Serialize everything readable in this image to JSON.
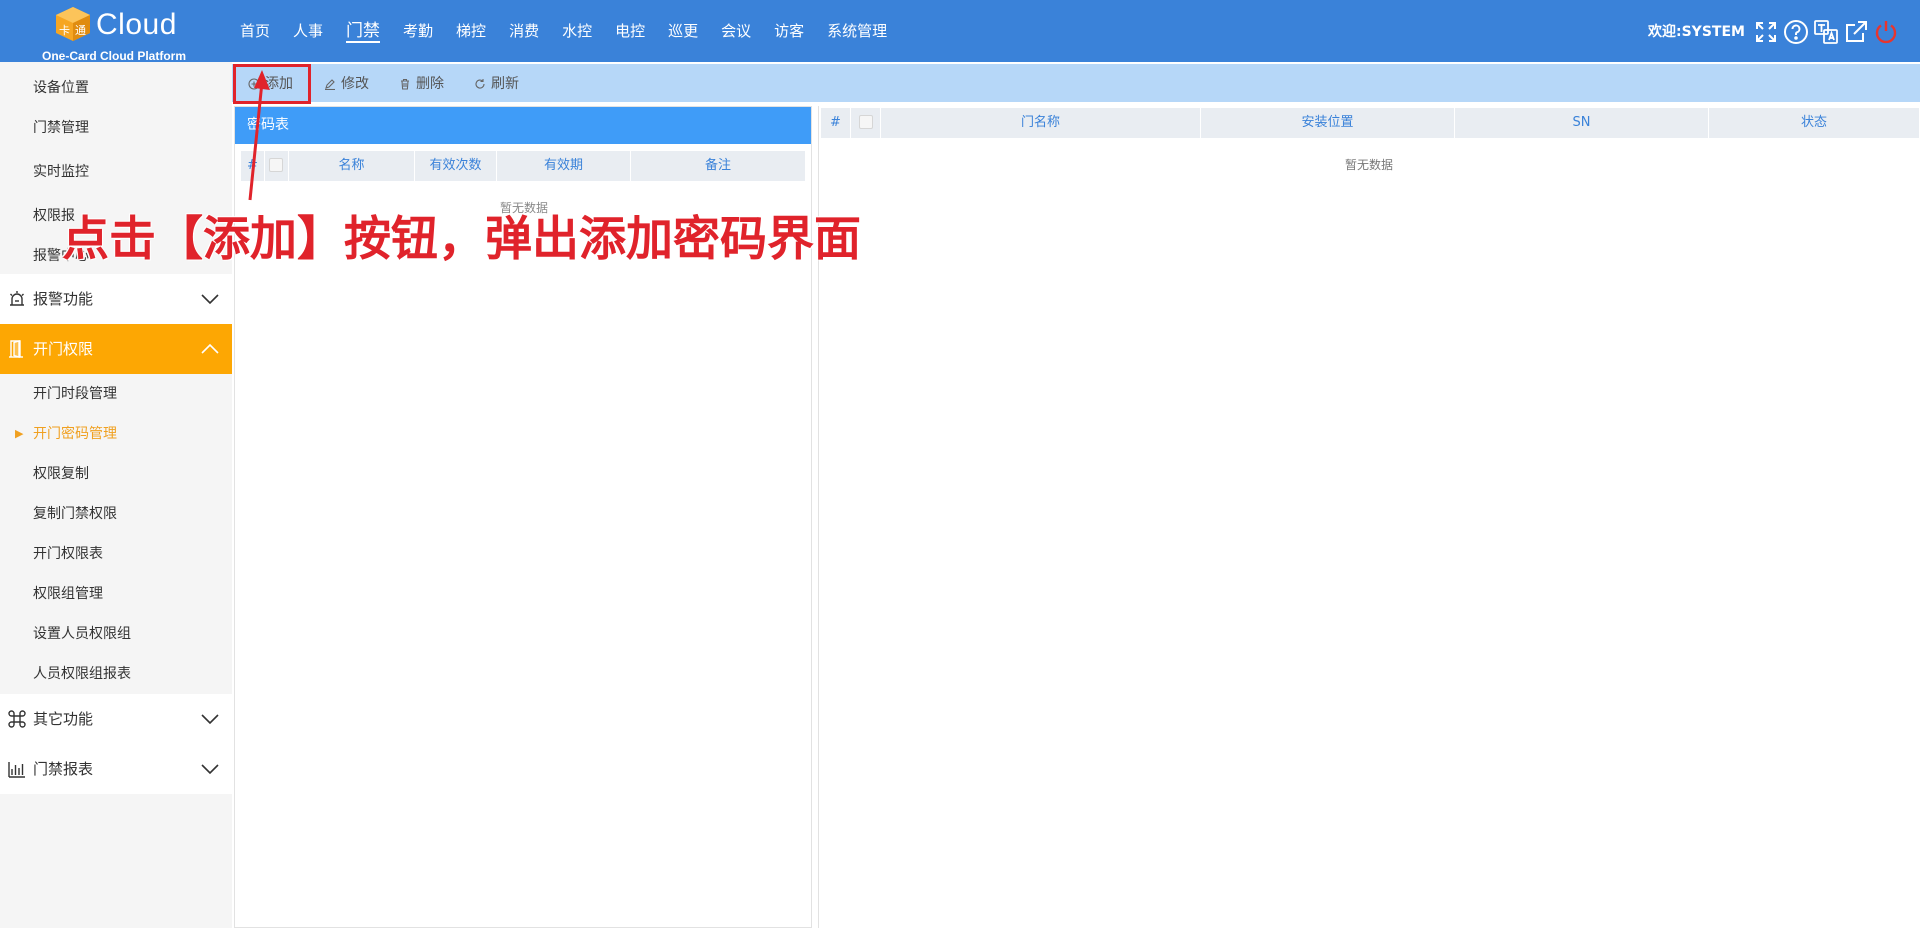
{
  "brand": {
    "word": "Cloud",
    "subtitle": "One-Card Cloud Platform",
    "accent": "#3a82d9"
  },
  "nav": [
    {
      "label": "首页"
    },
    {
      "label": "人事"
    },
    {
      "label": "门禁"
    },
    {
      "label": "考勤"
    },
    {
      "label": "梯控"
    },
    {
      "label": "消费"
    },
    {
      "label": "水控"
    },
    {
      "label": "电控"
    },
    {
      "label": "巡更"
    },
    {
      "label": "会议"
    },
    {
      "label": "访客"
    },
    {
      "label": "系统管理"
    }
  ],
  "nav_active": "门禁",
  "header": {
    "welcome": "欢迎:SYSTEM",
    "icons": [
      "fullscreen-icon",
      "help-icon",
      "translate-icon",
      "external-link-icon",
      "power-icon"
    ]
  },
  "sidebar": {
    "top_items": [
      {
        "label": "设备位置"
      },
      {
        "label": "门禁管理"
      },
      {
        "label": "实时监控"
      },
      {
        "label": "权限报"
      },
      {
        "label": "报警中心"
      }
    ],
    "group_alarm": {
      "label": "报警功能",
      "icon": "alarm-icon"
    },
    "group_door": {
      "label": "开门权限",
      "icon": "door-icon",
      "highlight": "#fda703"
    },
    "door_items": [
      {
        "label": "开门时段管理"
      },
      {
        "label": "开门密码管理"
      },
      {
        "label": "权限复制"
      },
      {
        "label": "复制门禁权限"
      },
      {
        "label": "开门权限表"
      },
      {
        "label": "权限组管理"
      },
      {
        "label": "设置人员权限组"
      },
      {
        "label": "人员权限组报表"
      }
    ],
    "door_active": "开门密码管理",
    "group_other": {
      "label": "其它功能",
      "icon": "command-icon"
    },
    "group_report": {
      "label": "门禁报表",
      "icon": "report-chart-icon"
    }
  },
  "toolbar": {
    "add": "添加",
    "edit": "修改",
    "delete": "删除",
    "refresh": "刷新"
  },
  "left_panel": {
    "title": "密码表",
    "columns": [
      "#",
      "名称",
      "有效次数",
      "有效期",
      "备注"
    ],
    "empty": "暂无数据"
  },
  "right_panel": {
    "columns": [
      "#",
      "门名称",
      "安装位置",
      "SN",
      "状态"
    ],
    "empty": "暂无数据"
  },
  "annotation": {
    "text": "点击【添加】按钮，弹出添加密码界面",
    "color": "#e0232b"
  }
}
